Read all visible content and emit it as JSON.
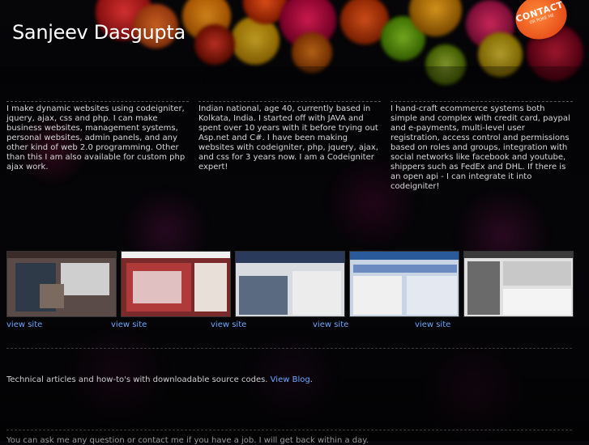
{
  "header": {
    "site_title": "Sanjeev Dasgupta",
    "contact_label": "CONTACT",
    "contact_sub": "OR POKE ME"
  },
  "about": {
    "columns": [
      "I make dynamic websites using codeigniter, jquery, ajax, css and php. I can make business websites, management systems, personal websites, admin panels, and any other kind of web 2.0 programming. Other than this I am also available for custom php ajax work.",
      "Indian national, age 40, currently based in Kolkata, India. I started off with JAVA and spent over 10 years with it before trying out Asp.net and C#. I have been making websites with codeigniter, php, jquery, ajax, and css for 3 years now. I am a Codeigniter expert!",
      "I hand-craft ecommerce systems both simple and complex with credit card, paypal and e-payments, multi-level user registration, access control and permissions based on roles and groups, integration with social networks like facebook and youtube, shippers such as FedEx and DHL. If there is an open api - I can integrate it into codeigniter!"
    ]
  },
  "portfolio": {
    "view_label": "view site"
  },
  "articles": {
    "text": "Technical articles and how-to's with downloadable source codes. ",
    "link_label": "View Blog",
    "after_link": "."
  },
  "footer": {
    "text": "You can ask me any question or contact me if you have a job. I will get back within a day."
  },
  "colors": {
    "link": "#6fa8ff",
    "accent_badge": "#e8501a"
  }
}
